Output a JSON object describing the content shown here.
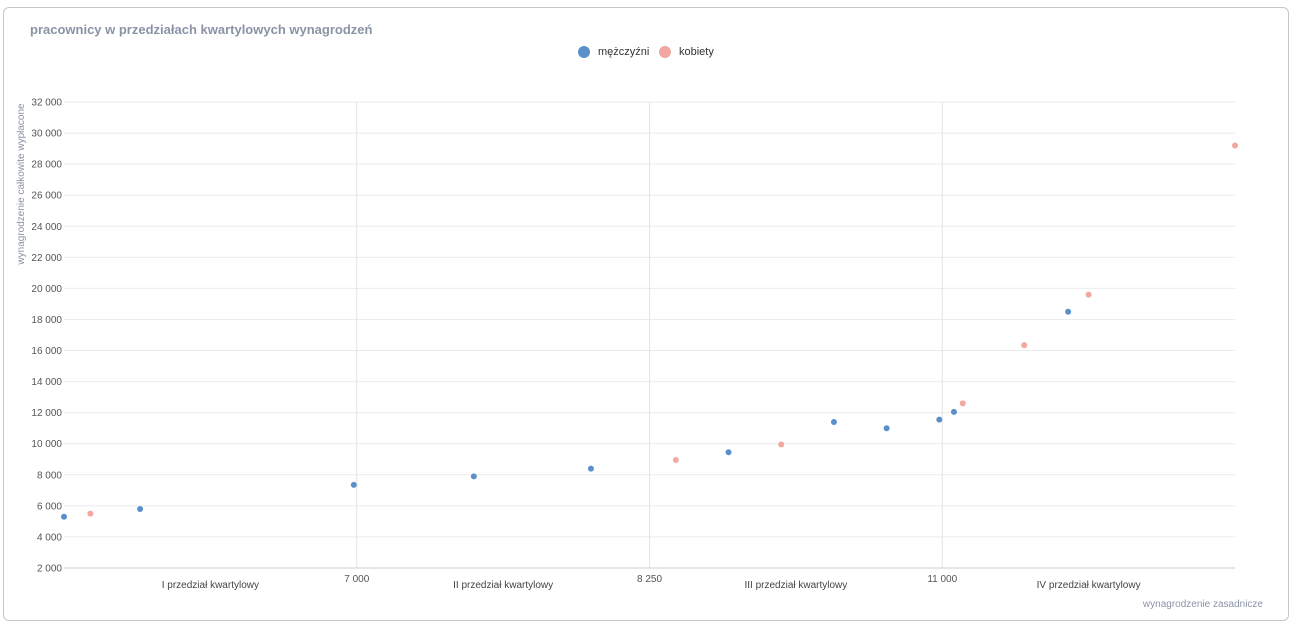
{
  "chart_data": {
    "type": "scatter",
    "title": "pracownicy w przedziałach kwartylowych wynagrodzeń",
    "xlabel": "wynagrodzenie zasadnicze",
    "ylabel": "wynagrodzenie całkowite wypłacone",
    "ylim": [
      2000,
      32000
    ],
    "y_ticks": [
      2000,
      4000,
      6000,
      8000,
      10000,
      12000,
      14000,
      16000,
      18000,
      20000,
      22000,
      24000,
      26000,
      28000,
      30000,
      32000
    ],
    "y_tick_labels": [
      "2 000",
      "4 000",
      "6 000",
      "8 000",
      "10 000",
      "12 000",
      "14 000",
      "16 000",
      "18 000",
      "20 000",
      "22 000",
      "24 000",
      "26 000",
      "28 000",
      "30 000",
      "32 000"
    ],
    "x_ticks": [
      7000,
      8250,
      11000
    ],
    "x_tick_labels": [
      "7 000",
      "8 250",
      "11 000"
    ],
    "quartile_bands": [
      {
        "label": "I przedział kwartylowy",
        "from": 0,
        "to": 1
      },
      {
        "label": "II przedział kwartylowy",
        "from": 1,
        "to": 2
      },
      {
        "label": "III przedział kwartylowy",
        "from": 2,
        "to": 3
      },
      {
        "label": "IV przedział kwartylowy",
        "from": 3,
        "to": 4
      }
    ],
    "legend_position": "top-center",
    "grid": true,
    "series": [
      {
        "name": "mężczyźni",
        "color": "#5b8fc9",
        "points": [
          {
            "q": 0.0,
            "y": 5300
          },
          {
            "q": 0.26,
            "y": 5800
          },
          {
            "q": 0.99,
            "y": 7350
          },
          {
            "q": 1.4,
            "y": 7900
          },
          {
            "q": 1.8,
            "y": 8400
          },
          {
            "q": 2.27,
            "y": 9450
          },
          {
            "q": 2.63,
            "y": 11400
          },
          {
            "q": 2.81,
            "y": 11000
          },
          {
            "q": 2.99,
            "y": 11550
          },
          {
            "q": 3.04,
            "y": 12050
          },
          {
            "q": 3.43,
            "y": 18500
          }
        ]
      },
      {
        "name": "kobiety",
        "color": "#f2a7a1",
        "points": [
          {
            "q": 0.09,
            "y": 5500
          },
          {
            "q": 2.09,
            "y": 8950
          },
          {
            "q": 2.45,
            "y": 9950
          },
          {
            "q": 3.07,
            "y": 12600
          },
          {
            "q": 3.28,
            "y": 16350
          },
          {
            "q": 3.5,
            "y": 19600
          },
          {
            "q": 4.0,
            "y": 29200
          }
        ]
      }
    ]
  }
}
